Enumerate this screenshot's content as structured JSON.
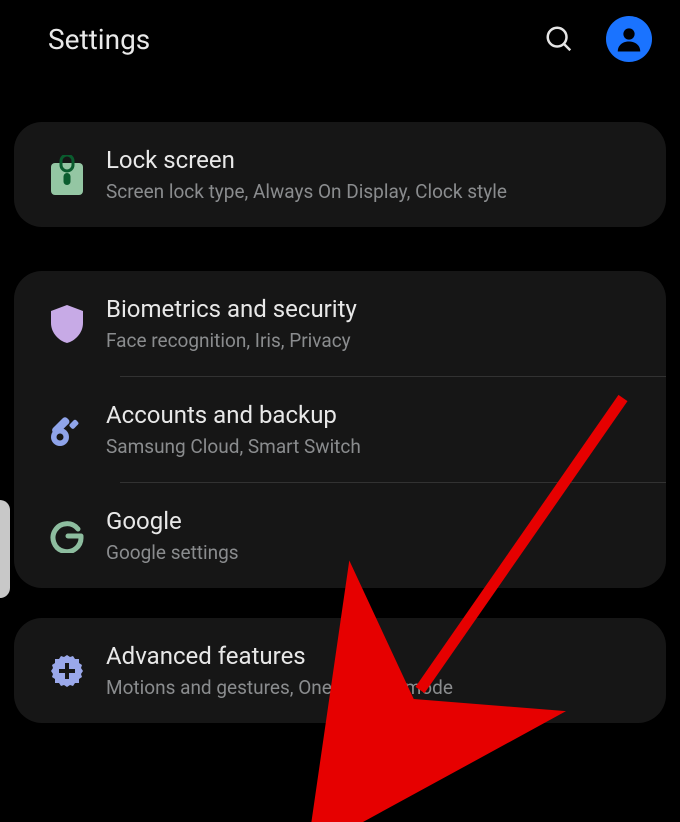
{
  "header": {
    "title": "Settings"
  },
  "group1": {
    "lock": {
      "title": "Lock screen",
      "sub": "Screen lock type, Always On Display, Clock style"
    }
  },
  "group2": {
    "bio": {
      "title": "Biometrics and security",
      "sub": "Face recognition, Iris, Privacy"
    },
    "acct": {
      "title": "Accounts and backup",
      "sub": "Samsung Cloud, Smart Switch"
    },
    "google": {
      "title": "Google",
      "sub": "Google settings"
    }
  },
  "group3": {
    "adv": {
      "title": "Advanced features",
      "sub": "Motions and gestures, One-handed mode"
    }
  },
  "colors": {
    "lock_icon": "#94c6a3",
    "shield": "#c7aae6",
    "key": "#8fa4ea",
    "google": "#8dbd9f",
    "gear": "#9aa8ea",
    "avatar_bg": "#1a73ff"
  }
}
